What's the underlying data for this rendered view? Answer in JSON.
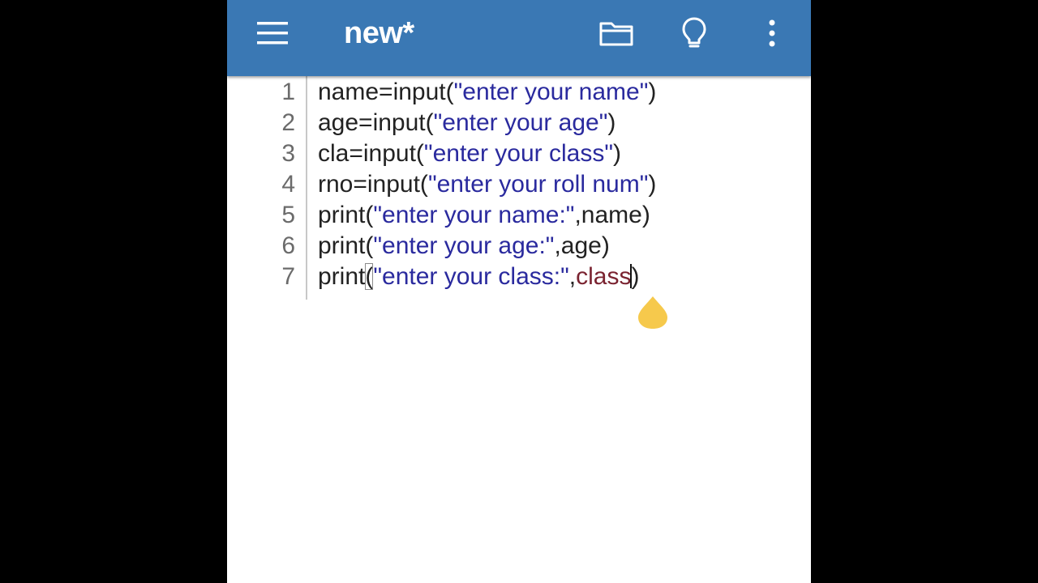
{
  "app": {
    "title": "new*",
    "menu_icon": "hamburger-menu-icon",
    "folder_icon": "folder-icon",
    "bulb_icon": "lightbulb-icon",
    "more_icon": "more-vertical-icon",
    "appbar_color": "#3a78b4"
  },
  "editor": {
    "lines": [
      {
        "number": "1",
        "text": "name=input(\"enter your name\")"
      },
      {
        "number": "2",
        "text": "age=input(\"enter your age\")"
      },
      {
        "number": "3",
        "text": "cla=input(\"enter your class\")"
      },
      {
        "number": "4",
        "text": "rno=input(\"enter your roll num\")"
      },
      {
        "number": "5",
        "text": "print(\"enter your name:\",name)"
      },
      {
        "number": "6",
        "text": "print(\"enter your age:\",age)"
      },
      {
        "number": "7",
        "text": "print(\"enter your class:\",class)"
      }
    ],
    "string_color": "#2a2a9e",
    "variable_color": "#7a2330",
    "text_color": "#222222",
    "handle_color": "#f6c94c"
  }
}
